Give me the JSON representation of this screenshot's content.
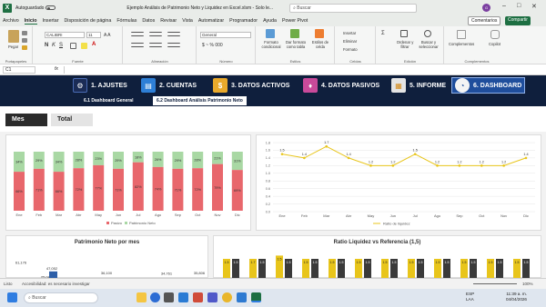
{
  "titlebar": {
    "autosave_label": "Autoguardado",
    "document_title": "Ejemplo Análisis de Patrimonio Neto y Liquidez en Excel.xlsm - Solo le...",
    "search_placeholder": "Buscar",
    "avatar_initials": "G"
  },
  "menu": {
    "items": [
      "Archivo",
      "Inicio",
      "Insertar",
      "Disposición de página",
      "Fórmulas",
      "Datos",
      "Revisar",
      "Vista",
      "Automatizar",
      "Programador",
      "Ayuda",
      "Power Pivot"
    ],
    "active": "Inicio",
    "comments_label": "Comentarios",
    "share_label": "Compartir"
  },
  "ribbon": {
    "clipboard": {
      "label": "Portapapeles",
      "paste": "Pegar"
    },
    "font": {
      "label": "Fuente",
      "font_name": "CALIBRI",
      "font_size": "11"
    },
    "alignment": {
      "label": "Alineación"
    },
    "number": {
      "label": "Número",
      "format": "General"
    },
    "styles": {
      "label": "Estilos",
      "conditional": "Formato condicional",
      "as_table": "Dar formato como tabla",
      "cell_styles": "Estilos de celda"
    },
    "cells": {
      "label": "Celdas",
      "insert": "Insertar",
      "delete": "Eliminar",
      "format": "Formato"
    },
    "editing": {
      "label": "Edición",
      "sort": "Ordenar y filtrar",
      "find": "Buscar y seleccionar"
    },
    "addins": {
      "label": "Complementos",
      "complements": "Complementos",
      "copilot": "Copilot"
    }
  },
  "formula_bar": {
    "cell_ref": "C1",
    "fx": "fx",
    "value": ""
  },
  "nav": {
    "tabs": [
      {
        "label": "1. AJUSTES",
        "icon": "settings-icon",
        "color": "#1b2c56"
      },
      {
        "label": "2. CUENTAS",
        "icon": "accounts-icon",
        "color": "#2e7fd6"
      },
      {
        "label": "3. DATOS ACTIVOS",
        "icon": "assets-icon",
        "color": "#e9a92b"
      },
      {
        "label": "4. DATOS PASIVOS",
        "icon": "liabilities-icon",
        "color": "#c94a9a"
      },
      {
        "label": "5. INFORME",
        "icon": "report-icon",
        "color": "#e4e4e4"
      },
      {
        "label": "6. DASHBOARD",
        "icon": "dashboard-icon",
        "color": "#f4f4f4"
      }
    ],
    "active": "6. DASHBOARD",
    "subtabs": [
      "6.1 Dashboard General",
      "6.2 Dashboard Análisis Patrimonio Neto"
    ],
    "active_subtab": "6.2 Dashboard Análisis Patrimonio Neto"
  },
  "filters": {
    "buttons": [
      "Mes",
      "Total"
    ],
    "selected": "Mes"
  },
  "colors": {
    "pasivo": "#e8676c",
    "patrimonio": "#a9d8a4",
    "ratio_line": "#e8c51b",
    "navy": "#0f1f3d",
    "excel_green": "#1d6f42"
  },
  "chart_data": [
    {
      "type": "bar",
      "stacked": "percent",
      "categories": [
        "Ene",
        "Feb",
        "Mar",
        "Abr",
        "May",
        "Jun",
        "Jul",
        "Ago",
        "Sep",
        "Oct",
        "Nov",
        "Dic"
      ],
      "series": [
        {
          "name": "Pasivo",
          "values": [
            66,
            71,
            66,
            72,
            77,
            71,
            82,
            74,
            71,
            72,
            79,
            69
          ]
        },
        {
          "name": "Patrimonio Neto",
          "values": [
            34,
            29,
            34,
            28,
            23,
            29,
            18,
            26,
            29,
            28,
            21,
            31
          ]
        }
      ],
      "data_labels": {
        "Pasivo": [
          "66%",
          "71%",
          "66%",
          "72%",
          "77%",
          "71%",
          "82%",
          "74%",
          "71%",
          "72%",
          "79%",
          "69%"
        ],
        "Patrimonio Neto": [
          "34%",
          "29%",
          "34%",
          "28%",
          "23%",
          "29%",
          "18%",
          "26%",
          "29%",
          "28%",
          "21%",
          "31%"
        ]
      },
      "legend": "bottom",
      "title": ""
    },
    {
      "type": "line",
      "x": [
        "Ene",
        "Feb",
        "Mar",
        "Abr",
        "May",
        "Jun",
        "Jul",
        "Ago",
        "Sep",
        "Oct",
        "Nov",
        "Dic"
      ],
      "series": [
        {
          "name": "Ratio de liquidez",
          "values": [
            1.5,
            1.4,
            1.7,
            1.4,
            1.2,
            1.2,
            1.5,
            1.2,
            1.2,
            1.2,
            1.2,
            1.4
          ]
        }
      ],
      "data_labels": [
        "1.5",
        "1.4",
        "1.7",
        "1.4",
        "1.2",
        "1.2",
        "1.5",
        "1.2",
        "1.2",
        "1.2",
        "1.2",
        "1.4"
      ],
      "ylim": [
        0,
        1.8
      ],
      "yticks": [
        "1.8",
        "1.6",
        "1.4",
        "1.2",
        "1.0",
        "0.8",
        "0.6",
        "0.4",
        "0.2",
        "0.0"
      ],
      "legend": "bottom",
      "grid": true,
      "title": ""
    },
    {
      "type": "bar",
      "title": "Patrimonio Neto por mes",
      "visible_labels": [
        "61,176",
        "25,088",
        "47,052",
        "36,100",
        "34,761",
        "35,806"
      ],
      "values": [
        61176,
        25088,
        47052,
        36100,
        34761,
        35806
      ]
    },
    {
      "type": "bar",
      "title": "Ratio Liquidez vs Referencia (1,5)",
      "visible_labels": [
        "1.5",
        "1.5",
        "1.7",
        "1.5",
        "1.5",
        "1.5",
        "1.5",
        "1.5",
        "1.5",
        "1.5",
        "1.5",
        "1.5",
        "1.5",
        "1.5",
        "1.5",
        "1.5",
        "1.5",
        "1.5",
        "1.5",
        "1.5",
        "1.5",
        "1.5",
        "1.5",
        "1.5"
      ],
      "values": [
        1.5,
        1.5,
        1.7,
        1.5,
        1.5,
        1.5,
        1.5,
        1.5,
        1.5,
        1.5,
        1.5,
        1.5
      ]
    }
  ],
  "status": {
    "sheet_tabs": "Listo",
    "accessibility": "Accesibilidad: es necesario investigar",
    "zoom": "100%"
  },
  "taskbar": {
    "search_placeholder": "Buscar",
    "lang": "ESP\nLAA",
    "time": "11:39 a. m.",
    "date": "04/04/2026"
  }
}
